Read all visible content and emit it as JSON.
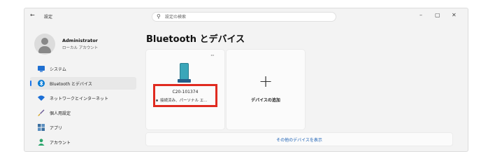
{
  "window": {
    "back_icon": "back-arrow-icon",
    "title": "設定",
    "controls": {
      "minimize": "–",
      "maximize": "▢",
      "close": "✕"
    }
  },
  "search": {
    "placeholder": "設定の検索",
    "value": "",
    "icon": "search-icon"
  },
  "profile": {
    "name": "Administrator",
    "subtitle": "ローカル アカウント"
  },
  "sidebar": {
    "items": [
      {
        "label": "システム",
        "icon": "monitor-icon",
        "icon_color": "#1f6fd1",
        "active": false
      },
      {
        "label": "Bluetooth とデバイス",
        "icon": "bluetooth-icon",
        "icon_color": "#0078d4",
        "active": true
      },
      {
        "label": "ネットワークとインターネット",
        "icon": "wifi-icon",
        "icon_color": "#1c6fd6",
        "active": false
      },
      {
        "label": "個人用設定",
        "icon": "brush-icon",
        "icon_color": "#6b5b95",
        "active": false
      },
      {
        "label": "アプリ",
        "icon": "apps-icon",
        "icon_color": "#3b6fa0",
        "active": false
      },
      {
        "label": "アカウント",
        "icon": "person-icon",
        "icon_color": "#2aa56b",
        "active": false
      }
    ]
  },
  "main": {
    "title": "Bluetooth とデバイス",
    "device": {
      "more_label": "···",
      "name": "C20-101374",
      "status": "接続済み、パーソナル エ...",
      "icon": "phone-icon"
    },
    "add_device": {
      "plus": "+",
      "label": "デバイスの追加",
      "icon": "plus-icon"
    },
    "show_more": "その他のデバイスを表示"
  },
  "colors": {
    "accent": "#1a73e8",
    "highlight": "#e02b20",
    "background": "#f3f3f3"
  }
}
